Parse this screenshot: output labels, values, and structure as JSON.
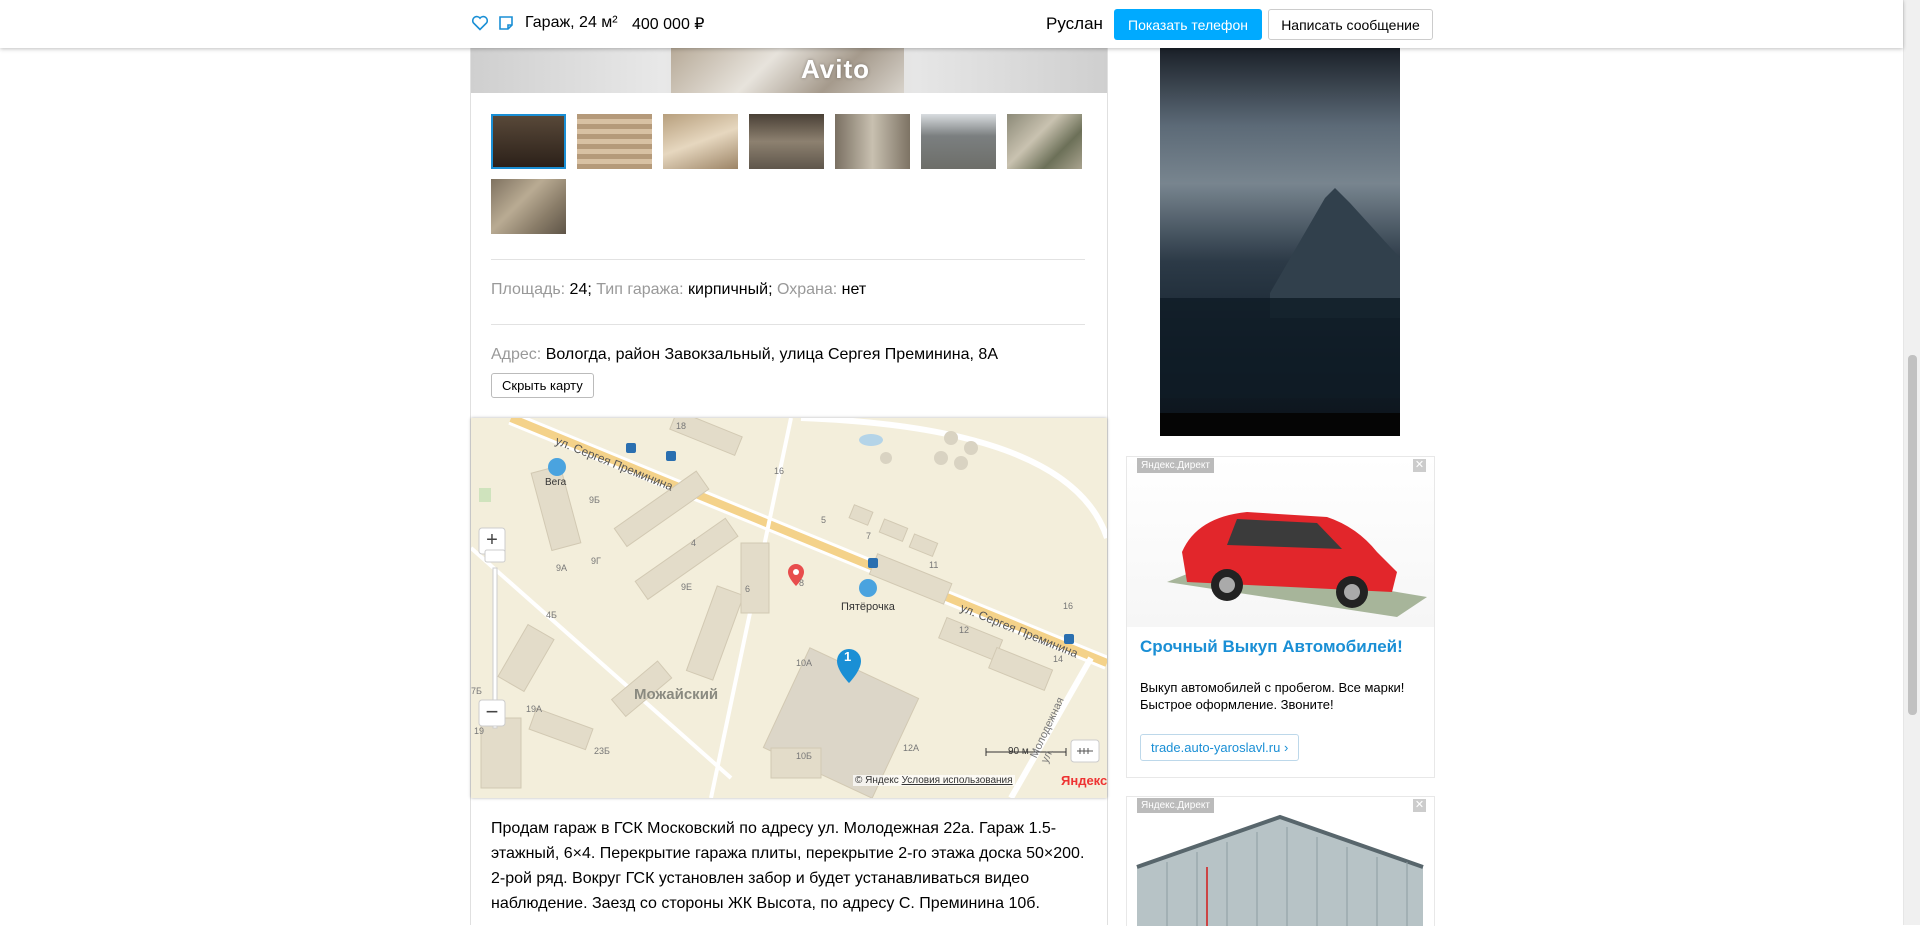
{
  "header": {
    "title": "Гараж, 24 м²",
    "price": "400 000",
    "currency": "₽",
    "seller": "Руслан",
    "show_phone_label": "Показать телефон",
    "write_message_label": "Написать сообщение"
  },
  "gallery": {
    "watermark": "Avito",
    "thumbnail_count": 8
  },
  "params": {
    "area_label": "Площадь:",
    "area_value": "24",
    "type_label": "Тип гаража:",
    "type_value": "кирпичный",
    "guard_label": "Охрана:",
    "guard_value": "нет"
  },
  "address": {
    "label": "Адрес:",
    "value": "Вологда, район Завокзальный, улица Сергея Преминина, 8А",
    "hide_map_label": "Скрыть карту"
  },
  "map": {
    "street_top": "ул. Сергея Преминина",
    "street_right": "ул. Сергея Преминина",
    "street_vertical": "Молодежная ул.",
    "district": "Можайский",
    "poi_1": "Вега",
    "poi_2": "Пятёрочка",
    "cluster_count": "1",
    "scale": "90 м",
    "copyright": "© Яндекс",
    "terms_link": "Условия использования",
    "brand": "Яндекс",
    "building_numbers": [
      "18",
      "16",
      "9Б",
      "5",
      "4",
      "9Г",
      "7",
      "9А",
      "11",
      "9Е",
      "6",
      "8",
      "4Б",
      "12",
      "16",
      "10А",
      "14",
      "19А",
      "7Б",
      "19",
      "23Б",
      "10Б",
      "12А"
    ]
  },
  "description": "Продам гараж в ГСК Московский по адресу ул. Молодежная 22а. Гараж 1.5-этажный, 6×4. Перекрытие гаража плиты, перекрытие 2-го этажа доска 50×200. 2-рой ряд. Вокруг ГСК установлен забор и будет устанавливаться видео наблюдение. Заезд со стороны ЖК Высота, по адресу С. Преминина 10б.",
  "ads": [
    {
      "label": "Яндекс.Директ",
      "title": "Срочный Выкуп Автомобилей!",
      "text": "Выкуп автомобилей с пробегом. Все марки! Быстрое оформление. Звоните!",
      "link": "trade.auto-yaroslavl.ru ›"
    },
    {
      "label": "Яндекс.Директ"
    }
  ]
}
